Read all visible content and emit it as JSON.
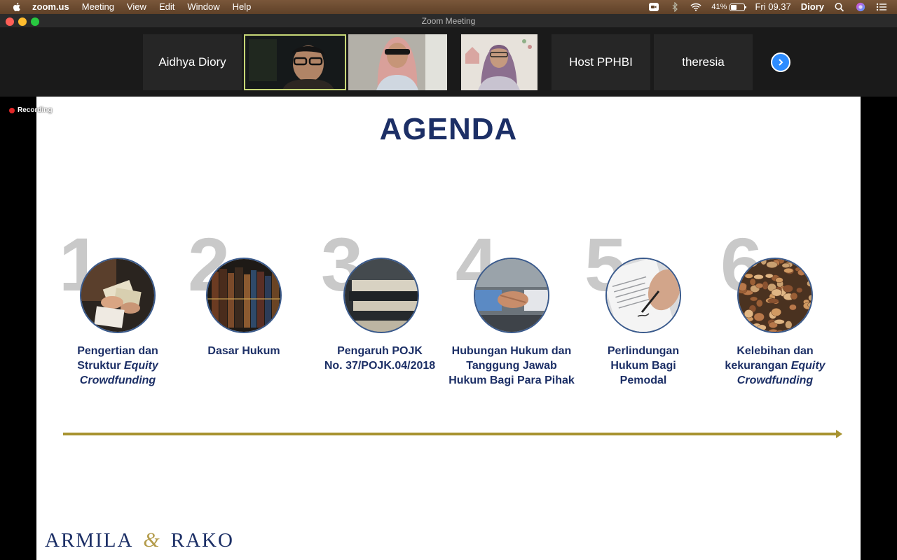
{
  "menubar": {
    "app_name": "zoom.us",
    "items": [
      "Meeting",
      "View",
      "Edit",
      "Window",
      "Help"
    ],
    "battery_percent": "41%",
    "battery_level": 0.41,
    "clock": "Fri 09.37",
    "user": "Diory"
  },
  "window": {
    "title": "Zoom Meeting"
  },
  "participants": {
    "names": [
      "Aidhya Diory",
      "Host PPHBI",
      "theresia"
    ]
  },
  "recording": {
    "label": "Recording"
  },
  "slide": {
    "title": "AGENDA",
    "items": [
      {
        "number": "1",
        "line1": "Pengertian dan",
        "line2a": "Struktur ",
        "line2b": "Equity",
        "line3": "Crowdfunding"
      },
      {
        "number": "2",
        "line1": "Dasar Hukum"
      },
      {
        "number": "3",
        "line1": "Pengaruh POJK",
        "line2": "No. 37/POJK.04/2018"
      },
      {
        "number": "4",
        "line1": "Hubungan Hukum dan",
        "line2": "Tanggung Jawab",
        "line3": "Hukum Bagi Para Pihak"
      },
      {
        "number": "5",
        "line1": "Perlindungan",
        "line2": "Hukum Bagi",
        "line3": "Pemodal"
      },
      {
        "number": "6",
        "line1": "Kelebihan dan",
        "line2a": "kekurangan ",
        "line2b": "Equity",
        "line3": "Crowdfunding"
      }
    ],
    "brand_left": "ARMILA",
    "brand_amp": "&",
    "brand_right": "RAKO"
  },
  "colors": {
    "title": "#1c2f66",
    "arrow": "#a89330",
    "accent": "#2d8cff"
  }
}
